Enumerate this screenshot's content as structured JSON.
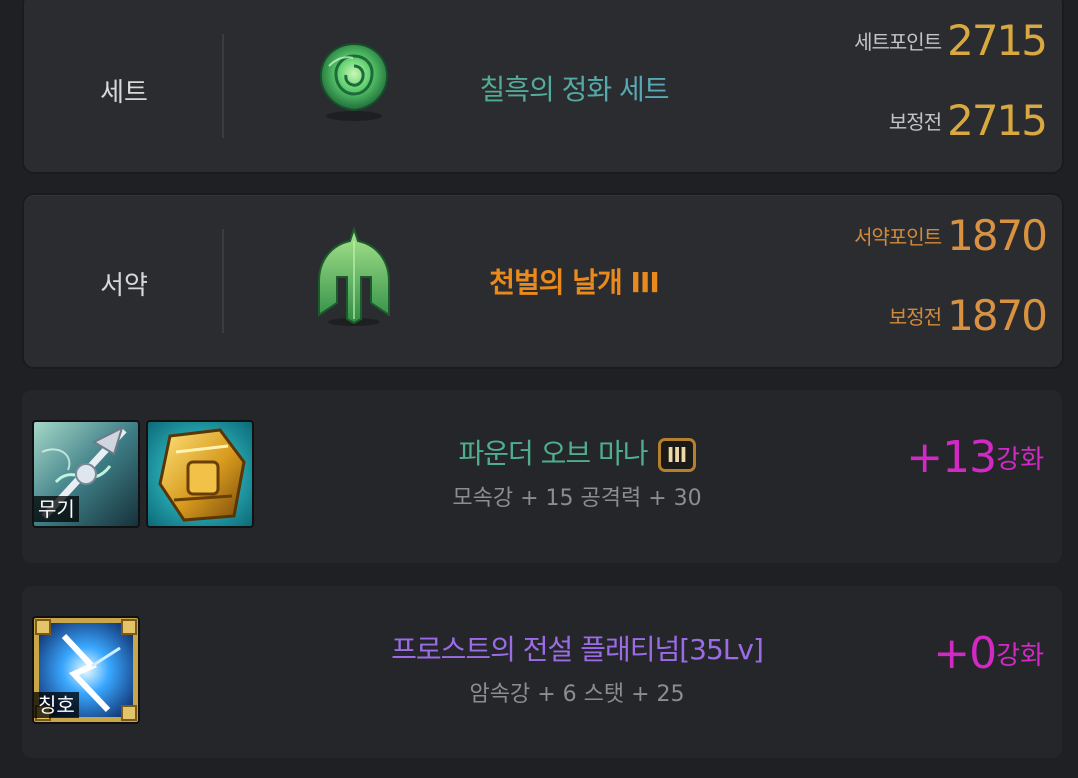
{
  "set_panel": {
    "category": "세트",
    "name": "칠흑의 정화 세트",
    "point_label": "세트포인트",
    "point_value": "2715",
    "base_label": "보정전",
    "base_value": "2715",
    "icon": "rose-icon"
  },
  "oath_panel": {
    "category": "서약",
    "name": "천벌의 날개 III",
    "point_label": "서약포인트",
    "point_value": "1870",
    "base_label": "보정전",
    "base_value": "1870",
    "icon": "helmet-icon"
  },
  "weapon_item": {
    "tag": "무기",
    "name": "파운더 오브 마나",
    "tier": "III",
    "stats": "모속강 + 15 공격력 + 30",
    "enhance_value": "+13",
    "enhance_label": "강화",
    "icons": [
      "weapon-icon",
      "gold-gauntlet-icon"
    ]
  },
  "title_item": {
    "tag": "칭호",
    "name": "프로스트의 전설 플래티넘[35Lv]",
    "stats": "암속강 + 6 스탯 + 25",
    "enhance_value": "+0",
    "enhance_label": "강화",
    "icon": "frost-title-icon"
  },
  "colors": {
    "background": "#1f2023",
    "panel": "#2b2c30",
    "gold": "#d9a93f",
    "orange": "#ea8a1d",
    "enhance_magenta": "#d229c5",
    "weapon_name": "#4fae8c",
    "title_name": "#9c6ce6"
  }
}
